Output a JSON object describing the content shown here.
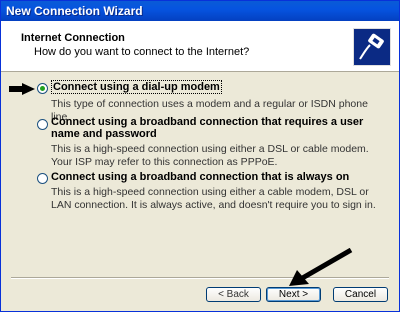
{
  "window": {
    "title": "New Connection Wizard"
  },
  "header": {
    "title": "Internet Connection",
    "subtitle": "How do you want to connect to the Internet?",
    "icon": "network-cable-icon"
  },
  "options": [
    {
      "label": "Connect using a dial-up modem",
      "description": "This type of connection uses a modem and a regular or ISDN phone line.",
      "selected": true
    },
    {
      "label": "Connect using a broadband connection that requires a user name and password",
      "description": "This is a high-speed connection using either a DSL or cable modem. Your ISP may refer to this connection as PPPoE.",
      "selected": false
    },
    {
      "label": "Connect using a broadband connection that is always on",
      "description": "This is a high-speed connection using either a cable modem, DSL or LAN connection. It is always active, and doesn't require you to sign in.",
      "selected": false
    }
  ],
  "buttons": {
    "back": "< Back",
    "next": "Next >",
    "cancel": "Cancel"
  },
  "colors": {
    "titlebar": "#0654e0",
    "radio_selected": "#21a121",
    "dialog_bg": "#ece9d8"
  }
}
